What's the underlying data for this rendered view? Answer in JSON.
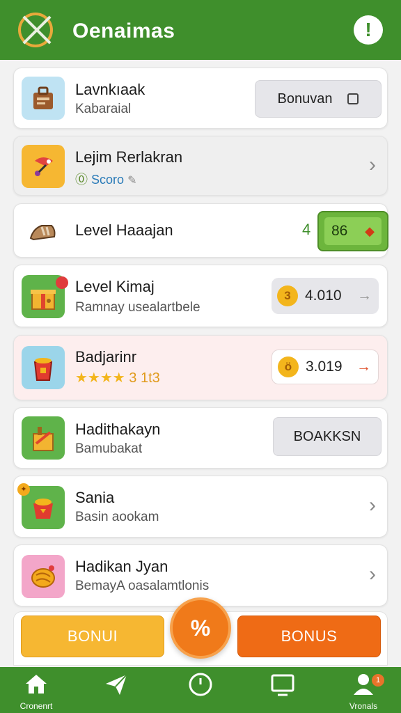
{
  "header": {
    "title": "Oenaimas",
    "alert_symbol": "!"
  },
  "rows": [
    {
      "title": "Lavnkıaak",
      "subtitle": "Kabaraial",
      "button": "Bonuvan"
    },
    {
      "title": "Lejim Rerlakran",
      "subtitle": "Scoro",
      "subtitle_prefix": "⓪"
    },
    {
      "title": "Level Haaajan",
      "badge_left": "4",
      "badge_value": "86"
    },
    {
      "title": "Level Kimaj",
      "subtitle": "Ramnay usealartbele",
      "coin": "3",
      "value": "4.010"
    },
    {
      "title": "Badjarinr",
      "stars": "★★★★",
      "rating_text": "3 1t3",
      "coin": "ö",
      "value": "3.019"
    },
    {
      "title": "Hadithakayn",
      "subtitle": "Bamubakat",
      "button": "BOAKKSN"
    },
    {
      "title": "Sania",
      "subtitle": "Basin aookam"
    },
    {
      "title": "Hadikan Jyan",
      "subtitle": "BemayA oasalamtlonis"
    }
  ],
  "bottom": {
    "left_button": "BONUI",
    "right_button": "BONUS",
    "fab": "%"
  },
  "nav": {
    "items": [
      {
        "label": "Cronenrt",
        "icon": "home-icon"
      },
      {
        "label": "",
        "icon": "send-icon"
      },
      {
        "label": "",
        "icon": "clock-icon"
      },
      {
        "label": "",
        "icon": "tv-icon"
      },
      {
        "label": "Vronals",
        "icon": "profile-icon",
        "badge": "1"
      }
    ]
  },
  "colors": {
    "primary": "#3f8f2c",
    "orange": "#f07a1a",
    "yellow": "#f6b732"
  }
}
